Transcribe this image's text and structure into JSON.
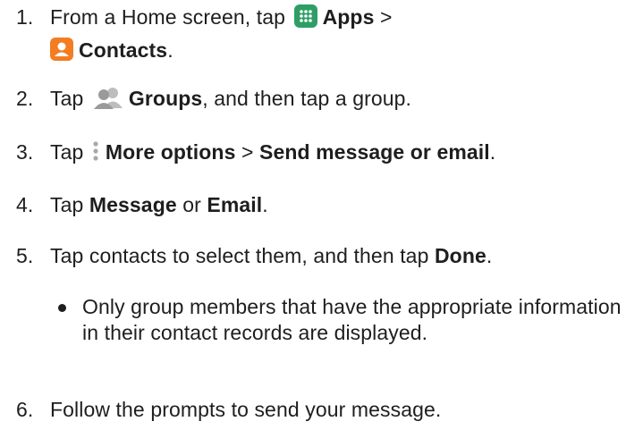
{
  "steps": [
    {
      "num": "1.",
      "t1": "From a Home screen, tap",
      "icon1": "apps-grid-icon",
      "b1": "Apps",
      "t2": " >",
      "icon2": "contacts-app-icon",
      "b2": "Contacts",
      "t3": "."
    },
    {
      "num": "2.",
      "t1": "Tap",
      "icon1": "groups-people-icon",
      "b1": "Groups",
      "t2": ", and then tap a group."
    },
    {
      "num": "3.",
      "t1": "Tap",
      "icon1": "more-options-vertical-dots-icon",
      "b1": "More options",
      "t2": " > ",
      "b2": "Send message or email",
      "t3": "."
    },
    {
      "num": "4.",
      "t1": "Tap ",
      "b1": "Message",
      "t2": " or ",
      "b2": "Email",
      "t3": "."
    },
    {
      "num": "5.",
      "t1": "Tap contacts to select them, and then tap ",
      "b1": "Done",
      "t2": "."
    },
    {
      "num": "6.",
      "t1": "Follow the prompts to send your message."
    }
  ],
  "bullet": {
    "text": "Only group members that have the appropriate information in their contact records are displayed."
  },
  "colors": {
    "text": "#1e1e1e",
    "apps_icon_bg": "#2f9e66",
    "contacts_icon_bg": "#f47c22",
    "groups_icon": "#a9a9a9"
  }
}
